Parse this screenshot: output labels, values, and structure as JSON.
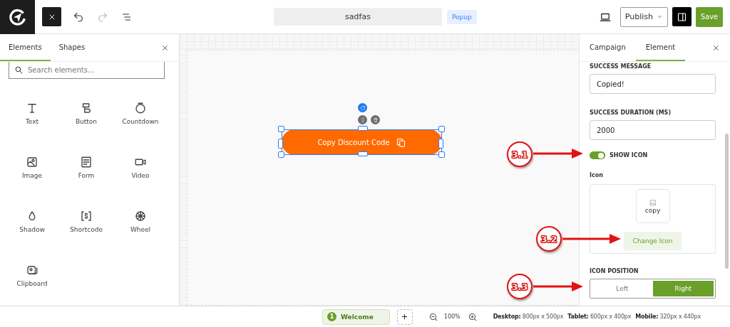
{
  "toolbar": {
    "title": "sadfas",
    "type_badge": "Popup",
    "publish": "Publish",
    "save": "Save"
  },
  "left_panel": {
    "tabs": [
      {
        "label": "Elements",
        "selected": true
      },
      {
        "label": "Shapes",
        "selected": false
      }
    ],
    "search": {
      "placeholder": "Search elements..."
    },
    "elements": [
      {
        "label": "Text",
        "kind": "text"
      },
      {
        "label": "Button",
        "kind": "button"
      },
      {
        "label": "Countdown",
        "kind": "countdown"
      },
      {
        "label": "Image",
        "kind": "image"
      },
      {
        "label": "Form",
        "kind": "form"
      },
      {
        "label": "Video",
        "kind": "video"
      },
      {
        "label": "Shadow",
        "kind": "shadow"
      },
      {
        "label": "Shortcode",
        "kind": "shortcode"
      },
      {
        "label": "Wheel",
        "kind": "wheel"
      },
      {
        "label": "Clipboard",
        "kind": "clipboard"
      }
    ]
  },
  "canvas": {
    "element": {
      "label": "Copy Discount Code",
      "selected": true
    }
  },
  "right_panel": {
    "tabs": [
      {
        "label": "Campaign",
        "selected": false
      },
      {
        "label": "Element",
        "selected": true
      }
    ],
    "fields": [
      {
        "label": "SUCCESS MESSAGE",
        "value": "Copied!"
      },
      {
        "label": "SUCCESS DURATION (MS)",
        "value": "2000"
      }
    ],
    "show_icon": {
      "label": "SHOW ICON",
      "on": true
    },
    "icon": {
      "label": "Icon",
      "preview": "copy",
      "button": "Change Icon"
    },
    "icon_position": {
      "label": "ICON POSITION",
      "options": [
        {
          "label": "Left",
          "selected": false
        },
        {
          "label": "Right",
          "selected": true
        }
      ]
    }
  },
  "annotations": [
    {
      "label": "3.1"
    },
    {
      "label": "3.2"
    },
    {
      "label": "3.3"
    }
  ],
  "status_bar": {
    "pages": [
      {
        "number": "1",
        "label": "Welcome",
        "selected": true
      }
    ],
    "zoom": "100%",
    "sizes": [
      {
        "device": "Desktop:",
        "size": "800px x 500px"
      },
      {
        "device": "Tablet:",
        "size": "600px x 400px"
      },
      {
        "device": "Mobile:",
        "size": "320px x 440px"
      }
    ]
  }
}
